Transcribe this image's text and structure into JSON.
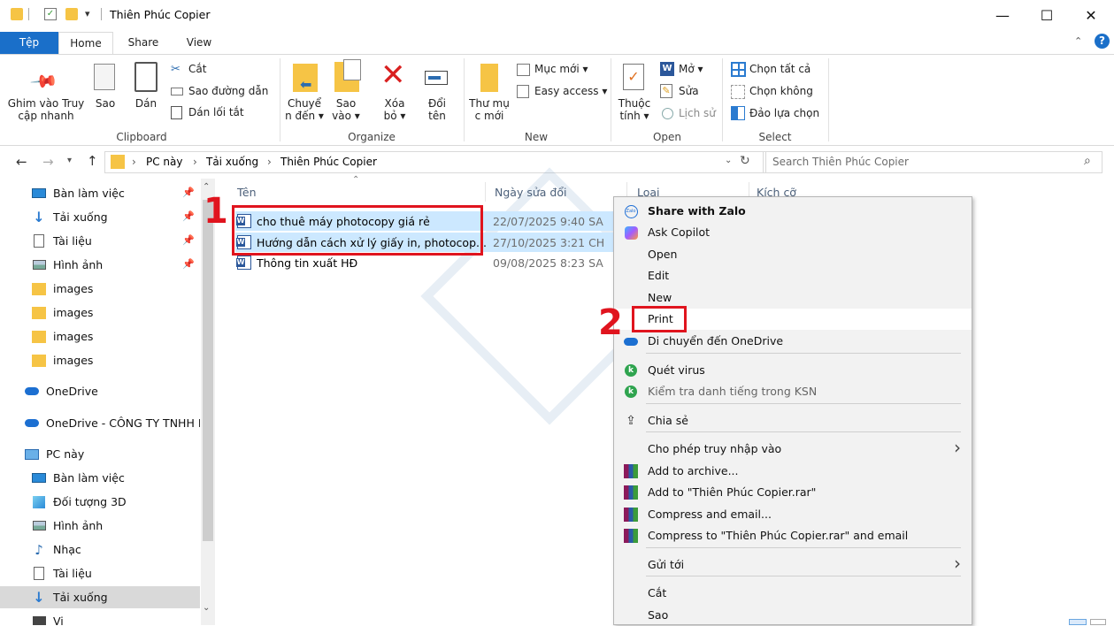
{
  "window": {
    "title": "Thiên Phúc Copier",
    "minimize": "—",
    "maximize": "☐",
    "close": "✕",
    "help": "?"
  },
  "tabs": [
    {
      "label": "Tệp",
      "active": false,
      "accent": "#1a6fc9"
    },
    {
      "label": "Home",
      "active": true
    },
    {
      "label": "Share",
      "active": false
    },
    {
      "label": "View",
      "active": false
    }
  ],
  "ribbon": {
    "clipboard": {
      "pin": "Ghim vào Truy\ncập nhanh",
      "copy": "Sao",
      "paste": "Dán",
      "cut": "Cắt",
      "copy_path": "Sao đường dẫn",
      "paste_shortcut": "Dán lối tắt",
      "label": "Clipboard"
    },
    "organize": {
      "move": "Chuyể\nn đến ▾",
      "copyto": "Sao\nvào ▾",
      "delete": "Xóa\nbỏ ▾",
      "rename": "Đổi\ntên",
      "label": "Organize"
    },
    "new": {
      "folder": "Thư mụ\nc mới",
      "new_item": "Mục mới ▾",
      "easy_access": "Easy access ▾",
      "label": "New"
    },
    "open": {
      "properties": "Thuộc\ntính ▾",
      "open": "Mở ▾",
      "edit": "Sửa",
      "history": "Lịch sử",
      "label": "Open"
    },
    "select": {
      "all": "Chọn tất cả",
      "none": "Chọn không",
      "invert": "Đảo lựa chọn",
      "label": "Select"
    }
  },
  "address": {
    "crumbs": [
      "PC này",
      "Tải xuống",
      "Thiên Phúc Copier"
    ],
    "search_placeholder": "Search Thiên Phúc Copier"
  },
  "nav": {
    "items": [
      {
        "label": "Bàn làm việc",
        "icon": "desktop-icon",
        "pinned": true
      },
      {
        "label": "Tải xuống",
        "icon": "download-icon",
        "pinned": true
      },
      {
        "label": "Tài liệu",
        "icon": "documents-icon",
        "pinned": true
      },
      {
        "label": "Hình ảnh",
        "icon": "pictures-icon",
        "pinned": true
      },
      {
        "label": "images",
        "icon": "folder-icon",
        "pinned": false
      },
      {
        "label": "images",
        "icon": "folder-icon",
        "pinned": false
      },
      {
        "label": "images",
        "icon": "folder-icon",
        "pinned": false
      },
      {
        "label": "images",
        "icon": "folder-icon",
        "pinned": false
      },
      {
        "label": "OneDrive",
        "icon": "cloud-icon",
        "pinned": false
      },
      {
        "label": "OneDrive - CÔNG TY TNHH M",
        "icon": "cloud-icon",
        "pinned": false
      },
      {
        "label": "PC này",
        "icon": "pc-icon",
        "pinned": false
      },
      {
        "label": "Bàn làm việc",
        "icon": "desktop-icon",
        "pinned": false
      },
      {
        "label": "Đối tượng 3D",
        "icon": "cube-icon",
        "pinned": false
      },
      {
        "label": "Hình ảnh",
        "icon": "pictures-icon",
        "pinned": false
      },
      {
        "label": "Nhạc",
        "icon": "music-icon",
        "pinned": false
      },
      {
        "label": "Tài liệu",
        "icon": "documents-icon",
        "pinned": false
      },
      {
        "label": "Tải xuống",
        "icon": "download-icon",
        "pinned": false,
        "selected": true
      },
      {
        "label": "Vi",
        "icon": "video-icon",
        "pinned": false
      }
    ]
  },
  "files": {
    "columns": [
      "Tên",
      "Ngày sửa đổi",
      "Loại",
      "Kích cỡ"
    ],
    "rows": [
      {
        "name": "cho thuê máy photocopy giá rẻ",
        "date": "22/07/2025 9:40 SA",
        "selected": true
      },
      {
        "name": "Hướng dẫn cách xử lý giấy in, photocop...",
        "date": "27/10/2025 3:21 CH",
        "selected": true
      },
      {
        "name": "Thông tin xuất HĐ",
        "date": "09/08/2025 8:23 SA",
        "selected": false
      }
    ]
  },
  "context_menu": {
    "items": [
      {
        "label": "Share with Zalo",
        "icon": "zalo-icon",
        "bold": true
      },
      {
        "label": "Ask Copilot",
        "icon": "copilot-icon"
      },
      {
        "label": "Open",
        "icon": ""
      },
      {
        "label": "Edit",
        "icon": ""
      },
      {
        "label": "New",
        "icon": ""
      },
      {
        "label": "Print",
        "icon": "",
        "highlight": true
      },
      {
        "label": "Di chuyển đến OneDrive",
        "icon": "cloud-icon"
      },
      {
        "label": "Quét virus",
        "icon": "kaspersky-icon"
      },
      {
        "label": "Kiểm tra danh tiếng trong KSN",
        "icon": "kaspersky-icon"
      },
      {
        "label": "Chia sẻ",
        "icon": "share-icon"
      },
      {
        "label": "Cho phép truy nhập vào",
        "icon": "",
        "submenu": true
      },
      {
        "label": "Add to archive...",
        "icon": "winrar-icon"
      },
      {
        "label": "Add to \"Thiên Phúc Copier.rar\"",
        "icon": "winrar-icon"
      },
      {
        "label": "Compress and email...",
        "icon": "winrar-icon"
      },
      {
        "label": "Compress to \"Thiên Phúc Copier.rar\" and email",
        "icon": "winrar-icon"
      },
      {
        "label": "Gửi tới",
        "icon": "",
        "submenu": true
      },
      {
        "label": "Cắt",
        "icon": ""
      },
      {
        "label": "Sao",
        "icon": ""
      }
    ]
  },
  "annotations": {
    "step1": "1",
    "step2": "2"
  },
  "colors": {
    "accent": "#1a6fc9",
    "selection": "#cce8ff",
    "annotation": "#e0141e"
  }
}
